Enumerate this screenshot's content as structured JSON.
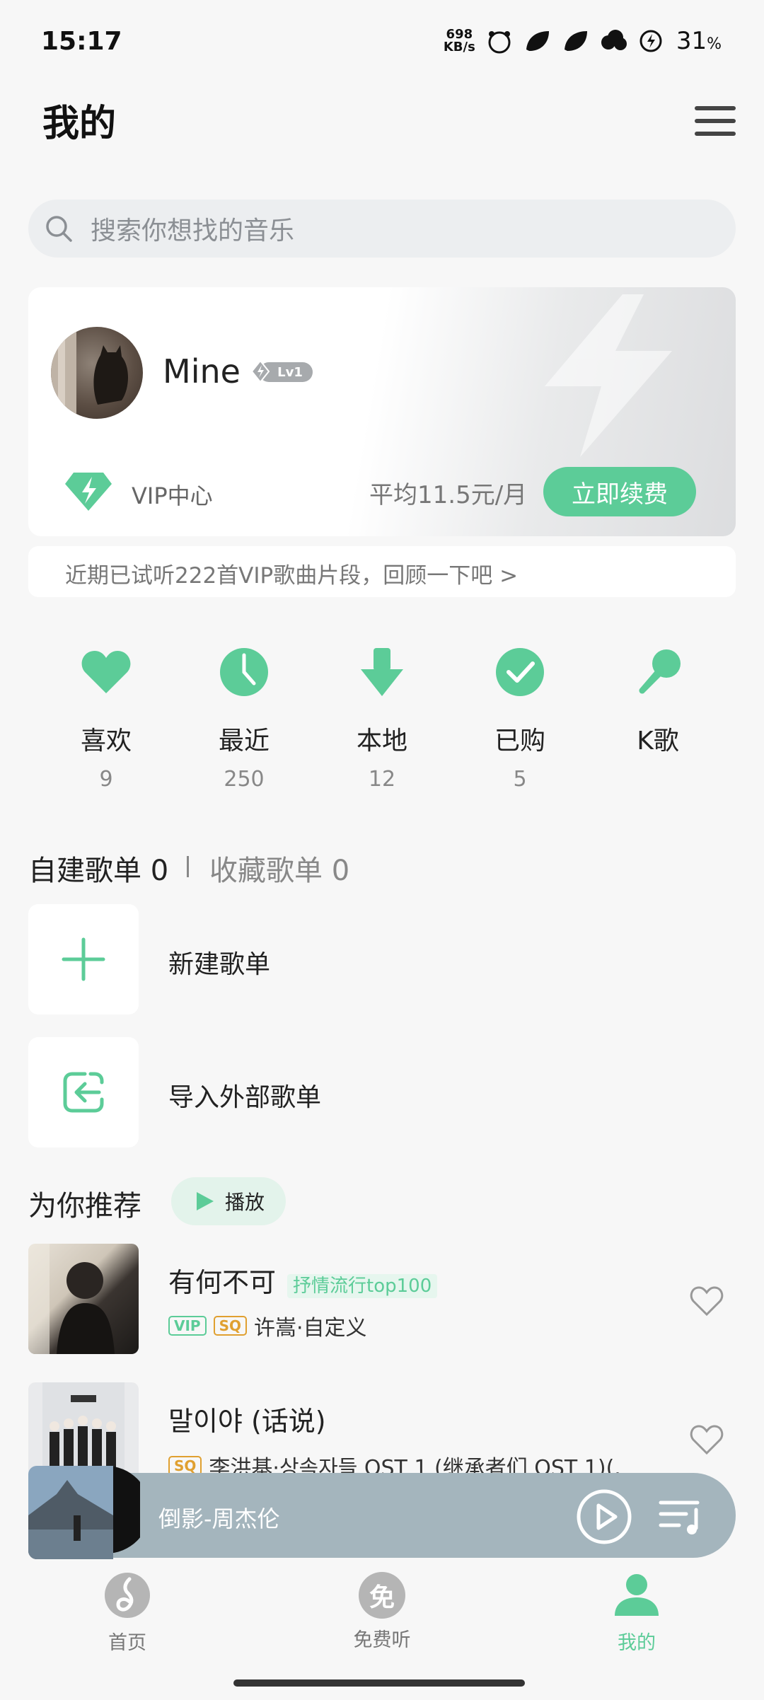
{
  "status_bar": {
    "time": "15:17",
    "net_speed_top": "698",
    "net_speed_bottom": "KB/s",
    "battery": "31",
    "battery_unit": "%"
  },
  "header": {
    "title": "我的",
    "menu_icon": "menu-icon"
  },
  "search": {
    "placeholder": "搜索你想找的音乐"
  },
  "profile": {
    "username": "Mine",
    "level": "Lv1",
    "vip_center": "VIP中心",
    "price": "平均11.5元/月",
    "renew_button": "立即续费",
    "trial_notice": "近期已试听222首VIP歌曲片段，回顾一下吧 >"
  },
  "quick_actions": [
    {
      "label": "喜欢",
      "count": "9",
      "icon": "heart-icon"
    },
    {
      "label": "最近",
      "count": "250",
      "icon": "clock-icon"
    },
    {
      "label": "本地",
      "count": "12",
      "icon": "download-icon"
    },
    {
      "label": "已购",
      "count": "5",
      "icon": "check-icon"
    },
    {
      "label": "K歌",
      "count": "",
      "icon": "microphone-icon"
    }
  ],
  "playlists": {
    "own_tab": "自建歌单 0",
    "fav_tab": "收藏歌单 0",
    "new_playlist": "新建歌单",
    "import_playlist": "导入外部歌单"
  },
  "recommend": {
    "title": "为你推荐",
    "play_button": "播放",
    "songs": [
      {
        "title": "有何不可",
        "tag": "抒情流行top100",
        "vip": "VIP",
        "sq": "SQ",
        "meta": "许嵩·自定义"
      },
      {
        "title": "말이야 (话说)",
        "tag": "",
        "vip": "",
        "sq": "SQ",
        "meta": "李洪基·상속자들 OST 1 (继承者们 OST 1)(..."
      }
    ]
  },
  "mini_player": {
    "track": "倒影-周杰伦"
  },
  "bottom_nav": [
    {
      "label": "首页",
      "icon": "home-music-icon"
    },
    {
      "label": "免费听",
      "icon": "free-listen-icon",
      "glyph": "免"
    },
    {
      "label": "我的",
      "icon": "profile-icon"
    }
  ],
  "colors": {
    "accent": "#5ccc98",
    "background": "#f7f7f7"
  }
}
